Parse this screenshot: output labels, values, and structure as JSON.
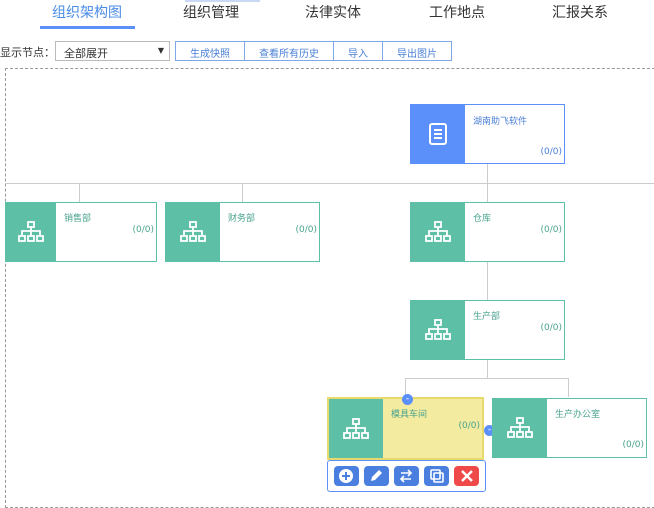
{
  "tabs": [
    {
      "label": "组织架构图",
      "active": true
    },
    {
      "label": "组织管理",
      "active": false
    },
    {
      "label": "法律实体",
      "active": false
    },
    {
      "label": "工作地点",
      "active": false
    },
    {
      "label": "汇报关系",
      "active": false
    }
  ],
  "toolbar": {
    "filter_label": "显示节点：",
    "selected_option": "全部展开",
    "buttons": [
      "生成快照",
      "查看所有历史",
      "导入",
      "导出图片"
    ]
  },
  "nodes": {
    "root": {
      "name": "湖南助飞软件",
      "count": "(0/0)"
    },
    "sales": {
      "name": "销售部",
      "count": "(0/0)"
    },
    "finance": {
      "name": "财务部",
      "count": "(0/0)"
    },
    "warehouse": {
      "name": "仓库",
      "count": "(0/0)"
    },
    "production": {
      "name": "生产部",
      "count": "(0/0)"
    },
    "mold_shop": {
      "name": "模具车间",
      "count": "(0/0)"
    },
    "prod_office": {
      "name": "生产办公室",
      "count": "(0/0)"
    }
  },
  "collapse_symbol": "-",
  "actions": [
    {
      "icon": "add-icon",
      "color": "#4a7fe0"
    },
    {
      "icon": "edit-icon",
      "color": "#4a7fe0"
    },
    {
      "icon": "transfer-icon",
      "color": "#4a7fe0"
    },
    {
      "icon": "copy-icon",
      "color": "#4a7fe0"
    },
    {
      "icon": "delete-icon",
      "color": "#f0494a"
    }
  ],
  "colors": {
    "primary": "#5b8ff9",
    "department": "#5cbfa6",
    "selected_bg": "#f3eba0",
    "delete": "#f0494a"
  }
}
